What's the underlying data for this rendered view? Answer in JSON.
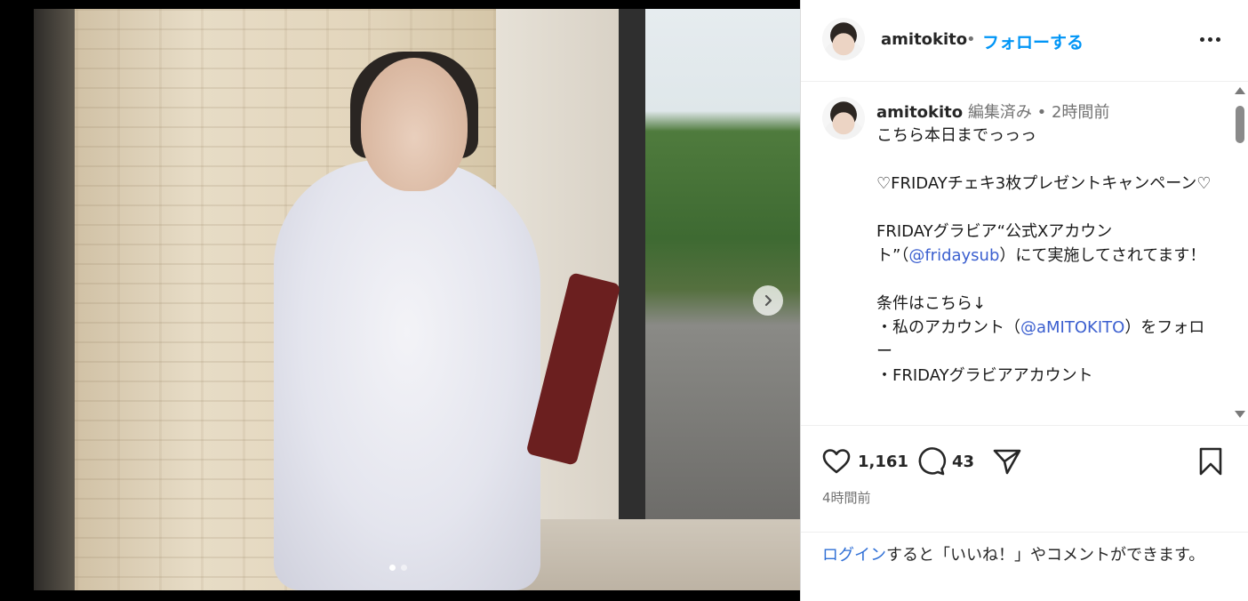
{
  "header": {
    "username": "amitokito",
    "separator": "•",
    "follow_label": "フォローする",
    "more_icon": "more-options-icon"
  },
  "caption": {
    "username": "amitokito",
    "meta": " 編集済み • 2時間前",
    "line1": "こちら本日までっっっ",
    "line2": "♡FRIDAYチェキ3枚プレゼントキャンペーン♡",
    "line3a": "FRIDAYグラビア“公式Xアカウント”（",
    "mention1": "@fridaysub",
    "line3b": "）にて実施してされてます！",
    "line4": "条件はこちら↓",
    "line5a": "・私のアカウント（",
    "mention2": "@aMITOKITO",
    "line5b": "）をフォロー",
    "line6": "・FRIDAYグラビアアカウント"
  },
  "actions": {
    "likes": "1,161",
    "comments": "43",
    "time_ago": "4時間前"
  },
  "login": {
    "link": "ログイン",
    "text": "すると「いいね！」やコメントができます。"
  },
  "carousel": {
    "slide_count": 2,
    "active_slide": 1
  },
  "colors": {
    "link_blue": "#0095f6",
    "text_dark": "#262626",
    "text_muted": "#737373"
  }
}
